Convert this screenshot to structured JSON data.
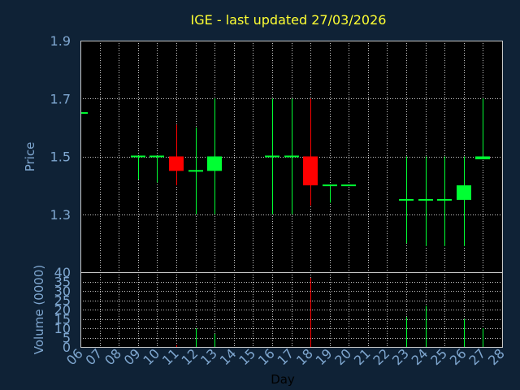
{
  "chart_data": {
    "type": "candlestick",
    "title": "IGE - last updated 27/03/2026",
    "xlabel": "Day",
    "price_panel": {
      "ylabel": "Price",
      "ylim": [
        1.1,
        1.9
      ],
      "y_ticks": [
        "1.9",
        "1.7",
        "1.5",
        "1.3"
      ],
      "grid": true
    },
    "volume_panel": {
      "ylabel": "Volume (0000)",
      "ylim": [
        0,
        40
      ],
      "y_ticks": [
        "40",
        "35",
        "30",
        "25",
        "20",
        "15",
        "10",
        "5",
        "0"
      ],
      "grid": true
    },
    "x_ticks": [
      "06",
      "07",
      "08",
      "09",
      "10",
      "11",
      "12",
      "13",
      "14",
      "15",
      "16",
      "17",
      "18",
      "19",
      "20",
      "21",
      "22",
      "23",
      "24",
      "25",
      "26",
      "27",
      "28"
    ],
    "candles": [
      {
        "day": 6,
        "open": 1.65,
        "close": 1.65,
        "high": 1.65,
        "low": 1.65,
        "volume": 0
      },
      {
        "day": 9,
        "open": 1.5,
        "close": 1.5,
        "high": 1.5,
        "low": 1.42,
        "volume": 0
      },
      {
        "day": 10,
        "open": 1.5,
        "close": 1.5,
        "high": 1.5,
        "low": 1.41,
        "volume": 0
      },
      {
        "day": 11,
        "open": 1.5,
        "close": 1.45,
        "high": 1.61,
        "low": 1.4,
        "volume": 1
      },
      {
        "day": 12,
        "open": 1.45,
        "close": 1.45,
        "high": 1.6,
        "low": 1.3,
        "volume": 10
      },
      {
        "day": 13,
        "open": 1.45,
        "close": 1.5,
        "high": 1.7,
        "low": 1.3,
        "volume": 7
      },
      {
        "day": 16,
        "open": 1.5,
        "close": 1.5,
        "high": 1.7,
        "low": 1.3,
        "volume": 0
      },
      {
        "day": 17,
        "open": 1.5,
        "close": 1.5,
        "high": 1.7,
        "low": 1.3,
        "volume": 0
      },
      {
        "day": 18,
        "open": 1.5,
        "close": 1.4,
        "high": 1.7,
        "low": 1.33,
        "volume": 37
      },
      {
        "day": 19,
        "open": 1.4,
        "close": 1.4,
        "high": 1.4,
        "low": 1.34,
        "volume": 0
      },
      {
        "day": 20,
        "open": 1.4,
        "close": 1.4,
        "high": 1.4,
        "low": 1.4,
        "volume": 0
      },
      {
        "day": 23,
        "open": 1.35,
        "close": 1.35,
        "high": 1.5,
        "low": 1.2,
        "volume": 16
      },
      {
        "day": 24,
        "open": 1.35,
        "close": 1.35,
        "high": 1.5,
        "low": 1.19,
        "volume": 22
      },
      {
        "day": 25,
        "open": 1.35,
        "close": 1.35,
        "high": 1.5,
        "low": 1.19,
        "volume": 0
      },
      {
        "day": 26,
        "open": 1.35,
        "close": 1.4,
        "high": 1.5,
        "low": 1.19,
        "volume": 15
      },
      {
        "day": 27,
        "open": 1.49,
        "close": 1.5,
        "high": 1.7,
        "low": 1.49,
        "volume": 10
      }
    ],
    "colors": {
      "background": "#0f2236",
      "plot_background": "#000000",
      "grid": "#c8c8c8",
      "up": "#00ff33",
      "down": "#ff0000",
      "flat": "#00ff33",
      "axis_text": "#7fa7d0",
      "title": "#ffff33"
    }
  }
}
